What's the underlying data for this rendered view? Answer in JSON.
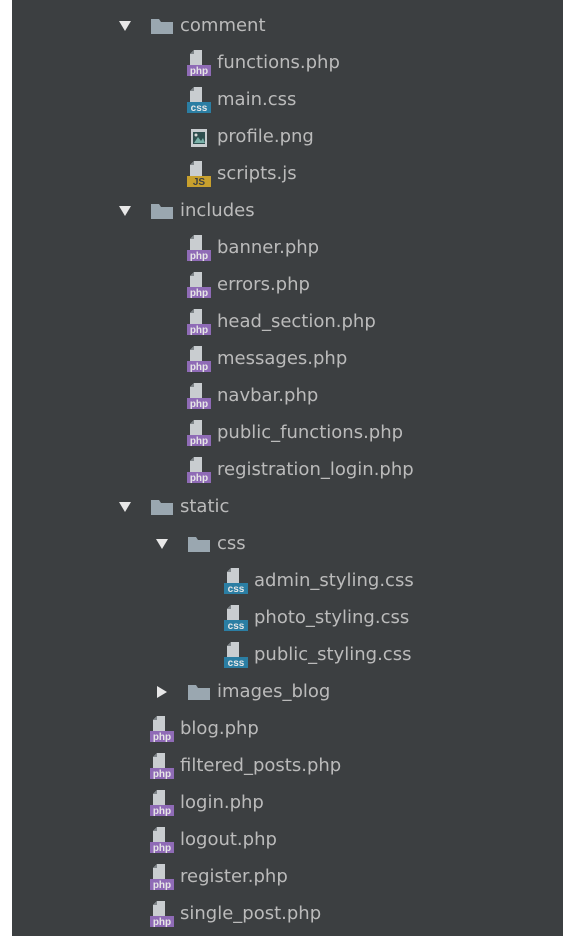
{
  "colors": {
    "background": "#3c3f41",
    "text": "#bbbbbb",
    "folder": "#9aa7b0",
    "file_sheet": "#c9cdd0",
    "php": "#8f6bb6",
    "css": "#2b7ea3",
    "js": "#c8a02d",
    "image": "#5a8f8a"
  },
  "tree": [
    {
      "label": "comment",
      "type": "folder",
      "expanded": true,
      "depth": 1,
      "icon": "folder-icon"
    },
    {
      "label": "functions.php",
      "type": "php",
      "depth": 2,
      "icon": "php-file-icon"
    },
    {
      "label": "main.css",
      "type": "css",
      "depth": 2,
      "icon": "css-file-icon"
    },
    {
      "label": "profile.png",
      "type": "image",
      "depth": 2,
      "icon": "image-file-icon"
    },
    {
      "label": "scripts.js",
      "type": "js",
      "depth": 2,
      "icon": "js-file-icon"
    },
    {
      "label": "includes",
      "type": "folder",
      "expanded": true,
      "depth": 1,
      "icon": "folder-icon"
    },
    {
      "label": "banner.php",
      "type": "php",
      "depth": 2,
      "icon": "php-file-icon"
    },
    {
      "label": "errors.php",
      "type": "php",
      "depth": 2,
      "icon": "php-file-icon"
    },
    {
      "label": "head_section.php",
      "type": "php",
      "depth": 2,
      "icon": "php-file-icon"
    },
    {
      "label": "messages.php",
      "type": "php",
      "depth": 2,
      "icon": "php-file-icon"
    },
    {
      "label": "navbar.php",
      "type": "php",
      "depth": 2,
      "icon": "php-file-icon"
    },
    {
      "label": "public_functions.php",
      "type": "php",
      "depth": 2,
      "icon": "php-file-icon"
    },
    {
      "label": "registration_login.php",
      "type": "php",
      "depth": 2,
      "icon": "php-file-icon"
    },
    {
      "label": "static",
      "type": "folder",
      "expanded": true,
      "depth": 1,
      "icon": "folder-icon"
    },
    {
      "label": "css",
      "type": "folder",
      "expanded": true,
      "depth": 2,
      "icon": "folder-icon"
    },
    {
      "label": "admin_styling.css",
      "type": "css",
      "depth": 3,
      "icon": "css-file-icon"
    },
    {
      "label": "photo_styling.css",
      "type": "css",
      "depth": 3,
      "icon": "css-file-icon"
    },
    {
      "label": "public_styling.css",
      "type": "css",
      "depth": 3,
      "icon": "css-file-icon"
    },
    {
      "label": "images_blog",
      "type": "folder",
      "expanded": false,
      "depth": 2,
      "icon": "folder-icon"
    },
    {
      "label": "blog.php",
      "type": "php",
      "depth": 1,
      "icon": "php-file-icon"
    },
    {
      "label": "filtered_posts.php",
      "type": "php",
      "depth": 1,
      "icon": "php-file-icon"
    },
    {
      "label": "login.php",
      "type": "php",
      "depth": 1,
      "icon": "php-file-icon"
    },
    {
      "label": "logout.php",
      "type": "php",
      "depth": 1,
      "icon": "php-file-icon"
    },
    {
      "label": "register.php",
      "type": "php",
      "depth": 1,
      "icon": "php-file-icon"
    },
    {
      "label": "single_post.php",
      "type": "php",
      "depth": 1,
      "icon": "php-file-icon"
    }
  ]
}
